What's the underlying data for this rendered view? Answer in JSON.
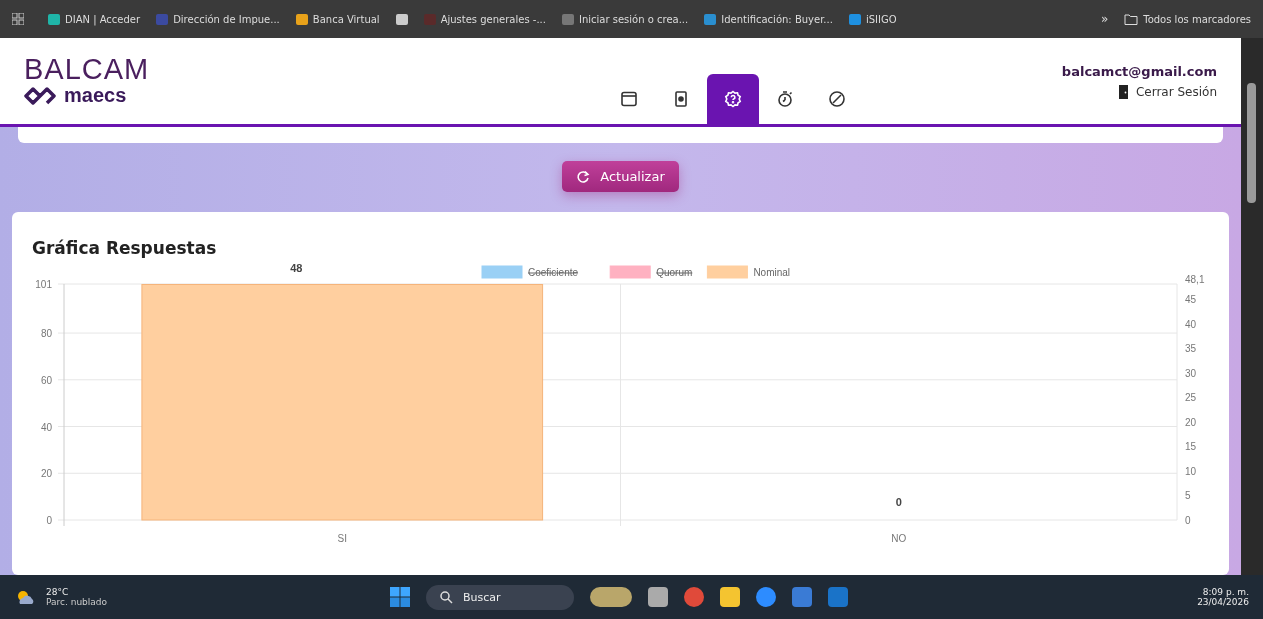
{
  "bookmarks_bar": {
    "items": [
      {
        "label": "DIAN | Acceder",
        "color": "#1fb5a8"
      },
      {
        "label": "Dirección de Impue...",
        "color": "#3b4aa0"
      },
      {
        "label": "Banca Virtual",
        "color": "#e8a21a"
      },
      {
        "color": "#cccccc"
      },
      {
        "label": "Ajustes generales -...",
        "color": "#5a2a2a"
      },
      {
        "label": "Iniciar sesión o crea...",
        "color": "#777777"
      },
      {
        "label": "Identificación: Buyer...",
        "color": "#2a8fd0"
      },
      {
        "label": "iSIIGO",
        "color": "#1e90e0"
      }
    ],
    "overflow": "»",
    "all_bookmarks": "Todos los marcadores"
  },
  "header": {
    "logo_top": "BALCAM",
    "logo_bottom": "maecs",
    "nav_tabs": [
      {
        "kind": "calendar",
        "selected": false
      },
      {
        "kind": "id-card",
        "selected": false
      },
      {
        "kind": "help",
        "selected": true
      },
      {
        "kind": "timer",
        "selected": false
      },
      {
        "kind": "cancel",
        "selected": false
      }
    ],
    "user_email": "balcamct@gmail.com",
    "logout": "Cerrar Sesión"
  },
  "refresh_button": "Actualizar",
  "chart_card": {
    "title": "Gráfica Respuestas",
    "chart_data": {
      "type": "bar",
      "categories": [
        "SI",
        "NO"
      ],
      "series": [
        {
          "name": "Coeficiente",
          "color": "#9ad0f5",
          "values": [
            null,
            null
          ]
        },
        {
          "name": "Quorum",
          "color": "#ffb1c1",
          "values": [
            null,
            null
          ]
        },
        {
          "name": "Nominal",
          "color": "#ffcf9f",
          "values": [
            48,
            0
          ]
        }
      ],
      "ylim": [
        0,
        48.1
      ],
      "yticks": [
        0,
        5,
        10,
        15,
        20,
        25,
        30,
        35,
        40,
        45,
        {
          "value": 48.1,
          "label": "48,1"
        }
      ],
      "y2lim": [
        0,
        101
      ],
      "y2ticks": [
        0,
        20,
        40,
        60,
        80,
        {
          "value": 101,
          "label": "101"
        }
      ],
      "grid": true,
      "value_labels": [
        "48",
        "0"
      ]
    },
    "legend": [
      {
        "crossed_out": true
      },
      {
        "crossed_out": true
      },
      {
        "crossed_out": false
      }
    ]
  },
  "taskbar": {
    "weather_temp": "28°C",
    "weather_desc": "Parc. nublado",
    "search": "Buscar",
    "time": "8:09 p. m.",
    "date": "23/04/2026"
  }
}
